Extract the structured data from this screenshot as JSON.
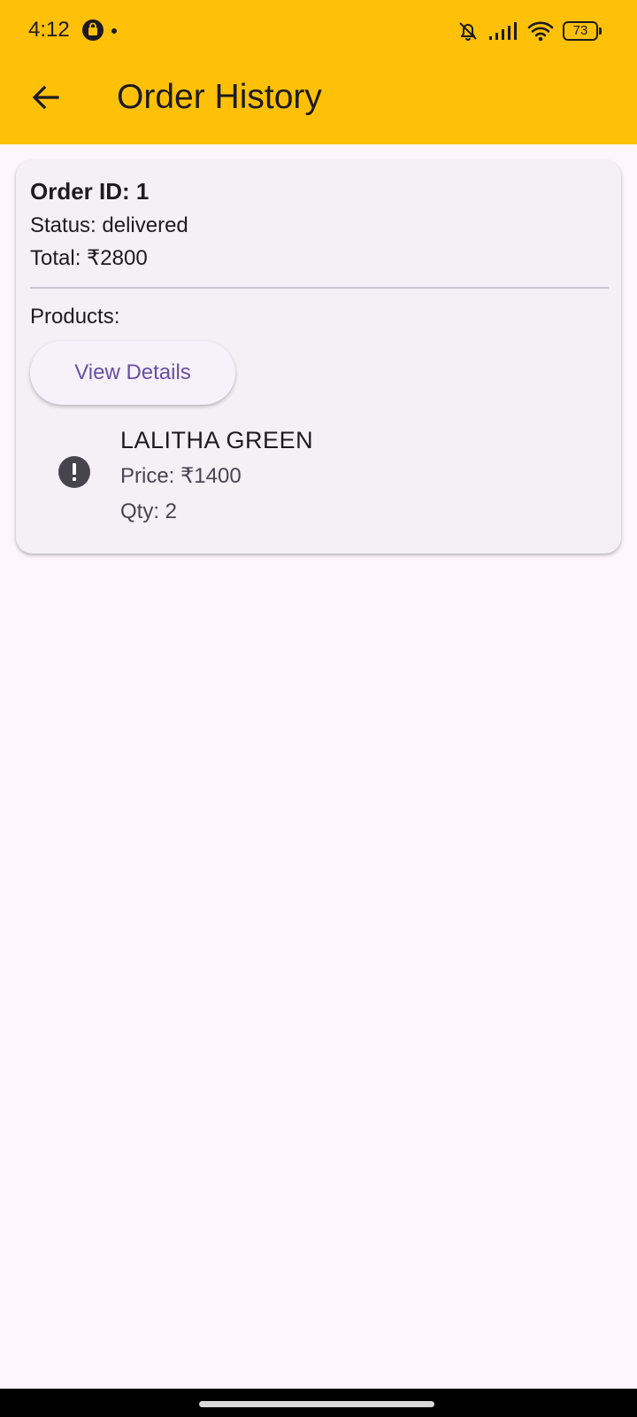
{
  "status_bar": {
    "time": "4:12",
    "battery": "73",
    "icons": [
      "shopping-bag-icon",
      "notifications-off-icon",
      "signal-icon",
      "wifi-icon",
      "battery-icon"
    ]
  },
  "app_bar": {
    "title": "Order History",
    "back_icon": "arrow-back-icon",
    "color": "#FFC107"
  },
  "order": {
    "id_text": "Order ID: 1",
    "status_text": "Status: delivered",
    "total_text": "Total: ₹2800",
    "products_label": "Products:",
    "view_details_label": "View Details",
    "products": [
      {
        "name": "LALITHA GREEN",
        "price_text": "Price: ₹1400",
        "qty_text": "Qty: 2",
        "icon": "error-icon"
      }
    ]
  },
  "colors": {
    "accent": "#6750A4",
    "background": "#FDF7FD",
    "card": "#F4F0F6"
  }
}
